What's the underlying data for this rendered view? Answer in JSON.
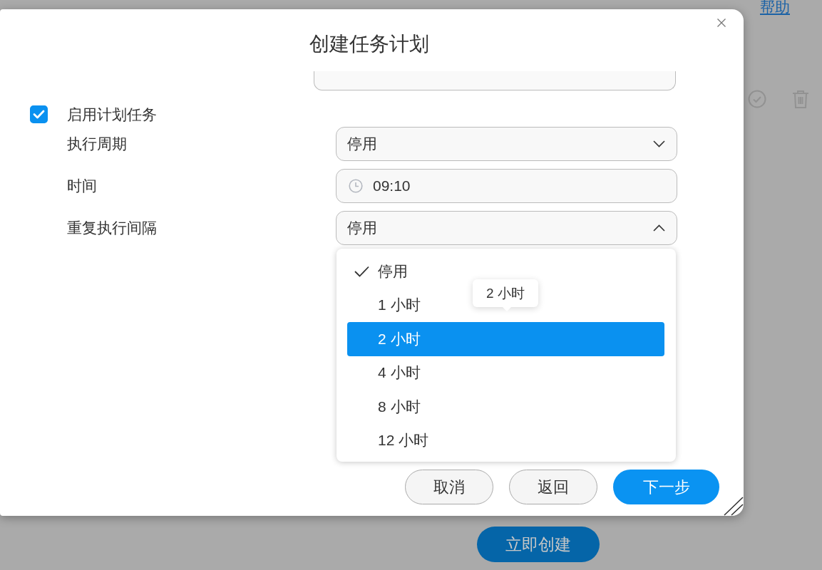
{
  "background": {
    "help_link": "帮助",
    "create_button": "立即创建"
  },
  "dialog": {
    "title": "创建任务计划",
    "enable_schedule": {
      "label": "启用计划任务",
      "checked": true
    },
    "fields": [
      {
        "kind": "select",
        "label": "执行周期",
        "value": "停用",
        "expanded": false
      },
      {
        "kind": "time",
        "label": "时间",
        "value": "09:10"
      },
      {
        "kind": "select",
        "label": "重复执行间隔",
        "value": "停用",
        "expanded": true,
        "options": [
          {
            "label": "停用",
            "selected": true,
            "highlighted": false
          },
          {
            "label": "1 小时",
            "selected": false,
            "highlighted": false
          },
          {
            "label": "2 小时",
            "selected": false,
            "highlighted": true
          },
          {
            "label": "4 小时",
            "selected": false,
            "highlighted": false
          },
          {
            "label": "8 小时",
            "selected": false,
            "highlighted": false
          },
          {
            "label": "12 小时",
            "selected": false,
            "highlighted": false
          }
        ],
        "tooltip": "2 小时"
      }
    ],
    "buttons": [
      {
        "label": "取消",
        "kind": "secondary"
      },
      {
        "label": "返回",
        "kind": "secondary"
      },
      {
        "label": "下一步",
        "kind": "primary"
      }
    ]
  }
}
